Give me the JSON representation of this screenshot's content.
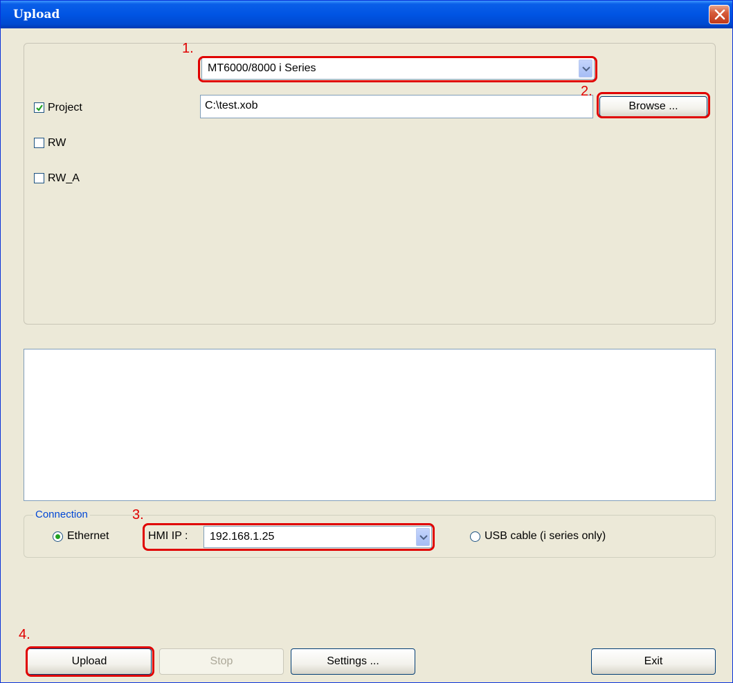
{
  "window": {
    "title": "Upload"
  },
  "device": {
    "selected": "MT6000/8000 i Series"
  },
  "files": {
    "project_path": "C:\\test.xob",
    "browse_label": "Browse ..."
  },
  "options": [
    {
      "label": "Project",
      "checked": true
    },
    {
      "label": "RW",
      "checked": false
    },
    {
      "label": "RW_A",
      "checked": false
    }
  ],
  "connection": {
    "legend": "Connection",
    "ethernet_label": "Ethernet",
    "hmi_ip_label": "HMI IP :",
    "hmi_ip_value": "192.168.1.25",
    "usb_label": "USB cable (i series only)",
    "selected": "Ethernet"
  },
  "buttons": {
    "upload": "Upload",
    "stop": "Stop",
    "settings": "Settings ...",
    "exit": "Exit"
  },
  "annotations": {
    "step1": "1.",
    "step2": "2.",
    "step3": "3.",
    "step4": "4."
  },
  "colors": {
    "annotation_red": "#e00000",
    "titlebar_blue": "#0054e3",
    "dialog_bg": "#ece9d8"
  }
}
